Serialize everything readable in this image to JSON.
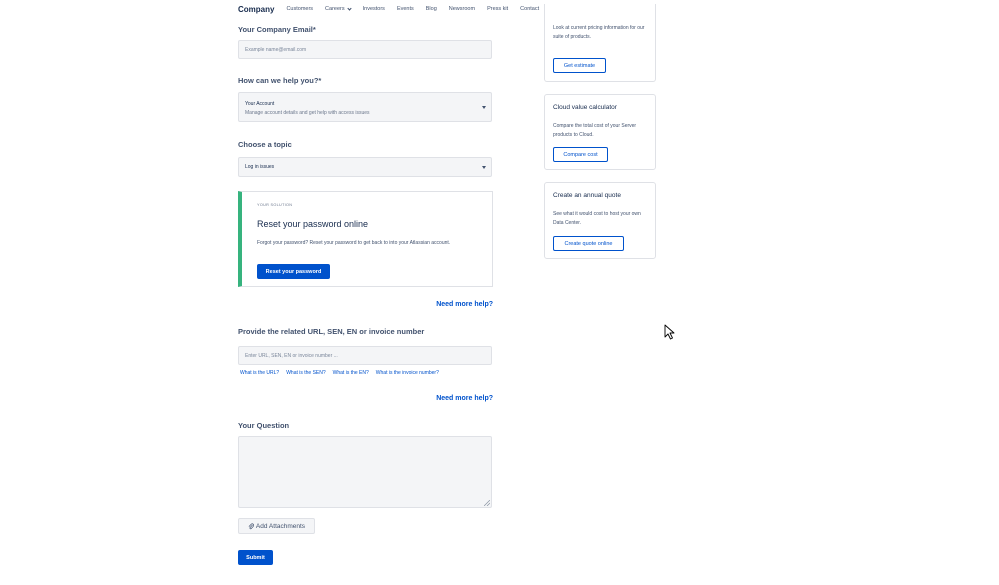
{
  "nav": {
    "brand": "Company",
    "items": [
      "Customers",
      "Careers",
      "Investors",
      "Events",
      "Blog",
      "Newsroom",
      "Press kit",
      "Contact"
    ]
  },
  "form": {
    "email": {
      "label": "Your Company Email*",
      "placeholder": "Example name@email.com"
    },
    "help": {
      "label": "How can we help you?*",
      "selected_title": "Your Account",
      "selected_sub": "Manage account details and get help with access issues"
    },
    "topic": {
      "label": "Choose a topic",
      "selected": "Log in issues"
    },
    "solution": {
      "kicker": "YOUR SOLUTION",
      "title": "Reset your password online",
      "text": "Forgot your password? Reset your password to get back to into your Atlassian account.",
      "button": "Reset your password"
    },
    "need_help_1": "Need more help?",
    "url": {
      "label": "Provide the related URL, SEN, EN or invoice number",
      "placeholder": "Enter URL, SEN, EN or invoice number ..."
    },
    "help_links": [
      "What is the URL?",
      "What is the SEN?",
      "What is the EN?",
      "What is the invoice number?"
    ],
    "need_help_2": "Need more help?",
    "question": {
      "label": "Your Question",
      "value": ""
    },
    "attach_label": "Add Attachments",
    "submit_label": "Submit"
  },
  "cards": [
    {
      "title": "",
      "text": "Look at current pricing information for our suite of products.",
      "button": "Get estimate"
    },
    {
      "title": "Cloud value calculator",
      "text": "Compare the total cost of your Server products to Cloud.",
      "button": "Compare cost"
    },
    {
      "title": "Create an annual quote",
      "text": "See what it would cost to host your own Data Center.",
      "button": "Create quote online"
    }
  ],
  "colors": {
    "primary": "#0052cc",
    "success": "#36b37e",
    "text": "#172b4d"
  }
}
